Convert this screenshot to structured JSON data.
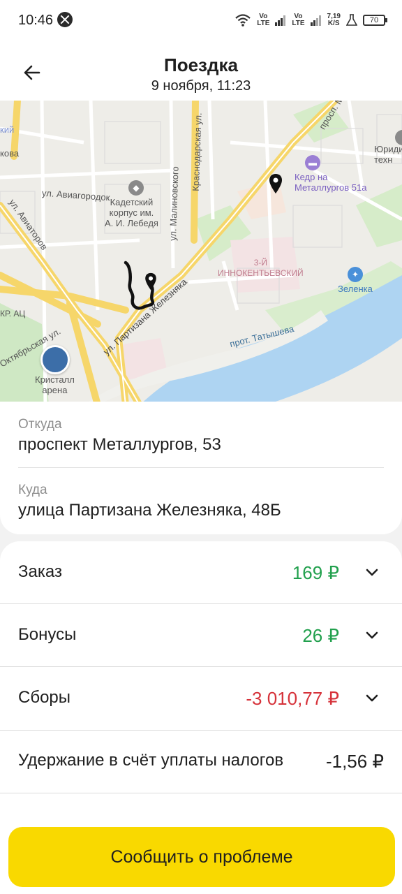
{
  "status_bar": {
    "time": "10:46",
    "net_1": "Vo\nLTE",
    "net_2": "Vo\nLTE",
    "speed": "7,19\nK/S",
    "battery": "70"
  },
  "header": {
    "title": "Поездка",
    "subtitle": "9 ноября, 11:23"
  },
  "map": {
    "labels": {
      "cadet": "Кадетский\nкорпус им.\nА. И. Лебедя",
      "kedr": "Кедр на\nМеталлургов 51а",
      "innokent": "3-Й\nИННОКЕНТЬЕВСКИЙ",
      "zelenka": "Зеленка",
      "kristall": "Кристалл\nарена",
      "avia": "ул. Авиагородок",
      "aviatorov": "ул. Авиаторов",
      "malinovskogo": "ул. Малиновского",
      "krasnodarskaya": "Краснодарская ул.",
      "partizana": "ул. Партизана Железняка",
      "tatysheva": "прот. Татышева",
      "oktyabrskaya": "Октябрьская ул.",
      "prospekt": "просп. М",
      "yuridich": "Юриди\nтехн",
      "kovo": "кова",
      "kiy": "кий",
      "rats": "КР. АЦ"
    }
  },
  "trip": {
    "from_label": "Откуда",
    "from_value": "проспект Металлургов, 53",
    "to_label": "Куда",
    "to_value": "улица Партизана Железняка, 48Б"
  },
  "finance": {
    "rows": [
      {
        "label": "Заказ",
        "amount": "169 ₽"
      },
      {
        "label": "Бонусы",
        "amount": "26 ₽"
      },
      {
        "label": "Сборы",
        "amount": "-3 010,77 ₽"
      },
      {
        "label": "Удержание в счёт уплаты налогов",
        "amount": "-1,56 ₽"
      }
    ]
  },
  "actions": {
    "report_label": "Сообщить о проблеме"
  },
  "colors": {
    "accent": "#f9d900",
    "positive": "#21a04d",
    "negative": "#d6323a"
  }
}
